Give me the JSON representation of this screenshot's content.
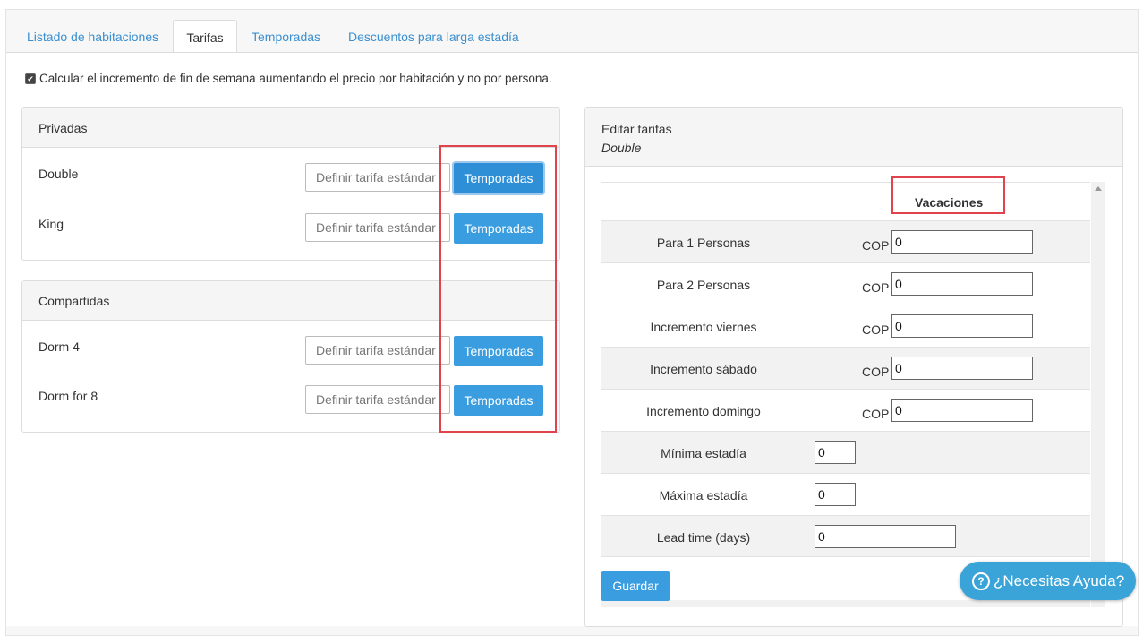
{
  "tabs": [
    {
      "label": "Listado de habitaciones",
      "active": false
    },
    {
      "label": "Tarifas",
      "active": true
    },
    {
      "label": "Temporadas",
      "active": false
    },
    {
      "label": "Descuentos para larga estadía",
      "active": false
    }
  ],
  "weekend_option": {
    "checked": true,
    "label": "Calcular el incremento de fin de semana aumentando el precio por habitación y no por persona."
  },
  "groups": [
    {
      "title": "Privadas",
      "rooms": [
        {
          "name": "Double",
          "placeholder": "Definir tarifa estándar",
          "button": "Temporadas"
        },
        {
          "name": "King",
          "placeholder": "Definir tarifa estándar",
          "button": "Temporadas"
        }
      ]
    },
    {
      "title": "Compartidas",
      "rooms": [
        {
          "name": "Dorm 4",
          "placeholder": "Definir tarifa estándar",
          "button": "Temporadas"
        },
        {
          "name": "Dorm for 8",
          "placeholder": "Definir tarifa estándar",
          "button": "Temporadas"
        }
      ]
    }
  ],
  "edit_panel": {
    "title": "Editar tarifas",
    "room": "Double",
    "season_header": "Vacaciones",
    "currency": "COP",
    "rows": [
      {
        "label": "Para 1 Personas",
        "value": "0"
      },
      {
        "label": "Para 2 Personas",
        "value": "0"
      },
      {
        "label": "Incremento viernes",
        "value": "0"
      },
      {
        "label": "Incremento sábado",
        "value": "0"
      },
      {
        "label": "Incremento domingo",
        "value": "0"
      },
      {
        "label": "Mínima estadía",
        "value": "0"
      },
      {
        "label": "Máxima estadía",
        "value": "0"
      },
      {
        "label": "Lead time (days)",
        "value": "0"
      }
    ],
    "save_label": "Guardar"
  },
  "help": {
    "label": "¿Necesitas Ayuda?"
  },
  "colors": {
    "accent": "#3a9de0",
    "highlight": "#e0434b",
    "help": "#3aa4d8"
  }
}
